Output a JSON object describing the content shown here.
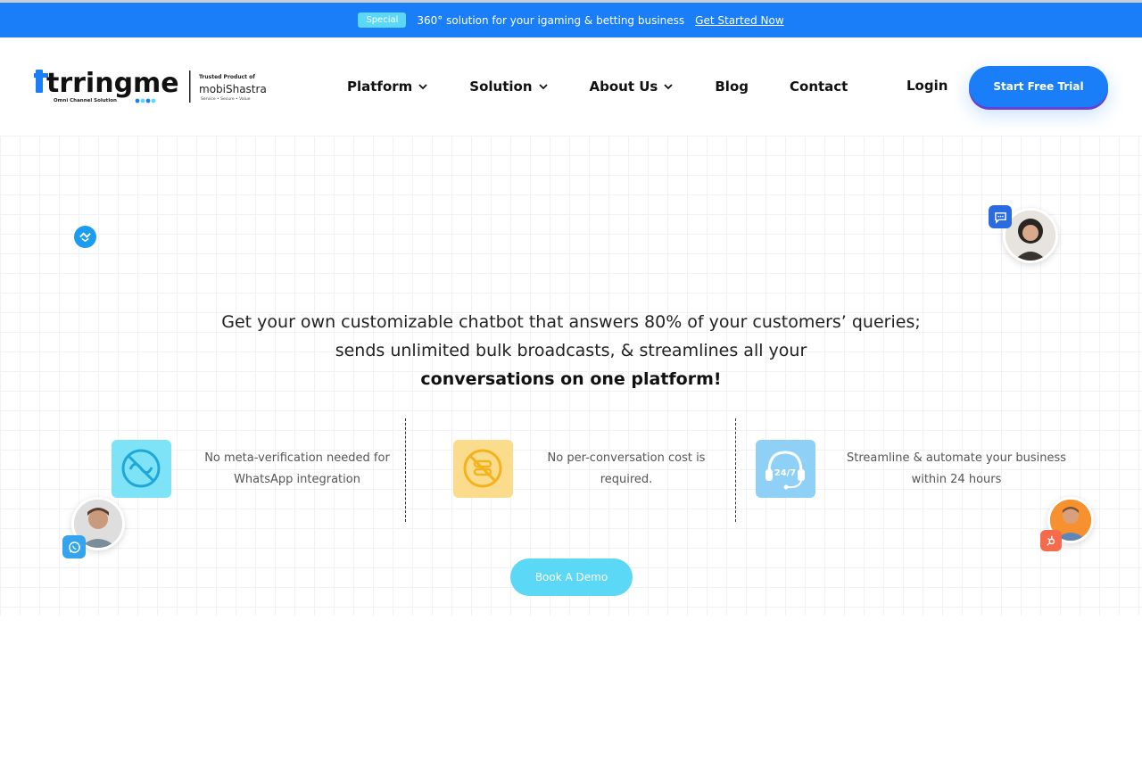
{
  "promo": {
    "badge": "Special",
    "text": "360° solution for your igaming & betting business",
    "link": "Get Started Now"
  },
  "brand": {
    "name": "trringme",
    "tagline": "Omni Channel Solution",
    "product_of": "Trusted Product of",
    "parent": "mobiShastra",
    "parent_tagline": "Service • Secure • Value"
  },
  "nav": {
    "items": [
      {
        "label": "Platform",
        "has_dropdown": true
      },
      {
        "label": "Solution",
        "has_dropdown": true
      },
      {
        "label": "About Us",
        "has_dropdown": true
      },
      {
        "label": "Blog",
        "has_dropdown": false
      },
      {
        "label": "Contact",
        "has_dropdown": false
      }
    ],
    "login": "Login",
    "cta": "Start Free Trial"
  },
  "hero": {
    "line1": "Get your own customizable chatbot that answers 80% of your customers’ queries;",
    "line2": "sends unlimited bulk broadcasts, & streamlines all your",
    "line3": "conversations on one platform!"
  },
  "features": [
    {
      "icon": "no-meta-icon",
      "line1": "No meta-verification needed for",
      "line2": "WhatsApp integration"
    },
    {
      "icon": "no-cost-icon",
      "line1": "No per-conversation cost is",
      "line2": "required."
    },
    {
      "icon": "support-24-7-icon",
      "line1": "Streamline & automate your business",
      "line2": "within 24 hours",
      "badge": "24/7"
    }
  ],
  "demo_button": "Book A Demo",
  "colors": {
    "primary": "#1a7ef8",
    "accent": "#5ad8f5",
    "feature1_bg": "#7fe3f7",
    "feature2_bg": "#fbdc8c",
    "feature3_bg": "#8fd0f7"
  }
}
